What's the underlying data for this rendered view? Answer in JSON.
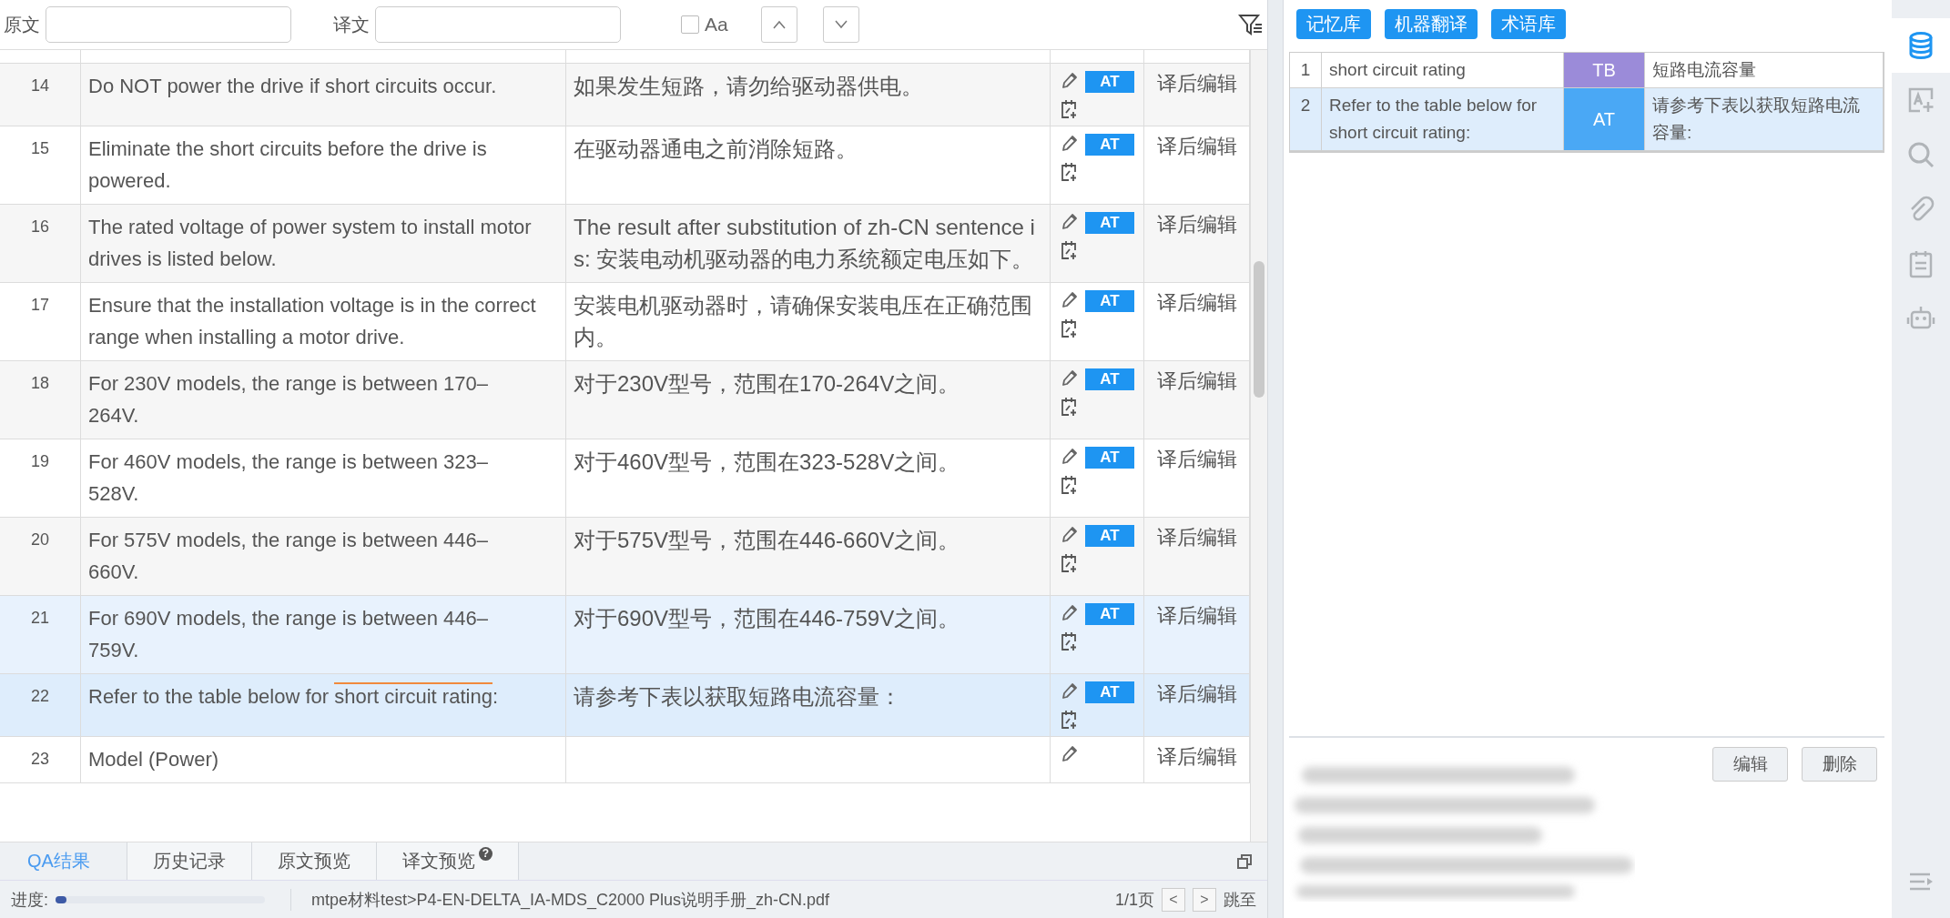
{
  "toolbar": {
    "source_label": "原文",
    "target_label": "译文",
    "case_label": "Aa",
    "case_checked": false
  },
  "segments": [
    {
      "number": "14",
      "source": "Do NOT power the drive if short circuits occur.",
      "target": "如果发生短路，请勿给驱动器供电。",
      "badge": "AT",
      "status": "译后编辑",
      "selected": false,
      "hovered": false
    },
    {
      "number": "15",
      "source": "Eliminate the short circuits before the drive is powered.",
      "target": "在驱动器通电之前消除短路。",
      "badge": "AT",
      "status": "译后编辑",
      "selected": false,
      "hovered": false
    },
    {
      "number": "16",
      "source": "The rated voltage of power system to install motor drives is listed below.",
      "target": "The result after substitution of zh-CN sentence is: 安装电动机驱动器的电力系统额定电压如下。",
      "badge": "AT",
      "status": "译后编辑",
      "selected": false,
      "hovered": false
    },
    {
      "number": "17",
      "source": "Ensure that the installation voltage is in the correct range when installing a motor drive.",
      "target": "安装电机驱动器时，请确保安装电压在正确范围内。",
      "badge": "AT",
      "status": "译后编辑",
      "selected": false,
      "hovered": false
    },
    {
      "number": "18",
      "source": "For 230V models, the range is between 170–264V.",
      "target": "对于230V型号，范围在170-264V之间。",
      "badge": "AT",
      "status": "译后编辑",
      "selected": false,
      "hovered": false
    },
    {
      "number": "19",
      "source": "For 460V models, the range is between 323–528V.",
      "target": "对于460V型号，范围在323-528V之间。",
      "badge": "AT",
      "status": "译后编辑",
      "selected": false,
      "hovered": false
    },
    {
      "number": "20",
      "source": "For 575V models, the range is between 446–660V.",
      "target": "对于575V型号，范围在446-660V之间。",
      "badge": "AT",
      "status": "译后编辑",
      "selected": false,
      "hovered": false
    },
    {
      "number": "21",
      "source": "For 690V models, the range is between 446–759V.",
      "target": "对于690V型号，范围在446-759V之间。",
      "badge": "AT",
      "status": "译后编辑",
      "selected": false,
      "hovered": true
    },
    {
      "number": "22",
      "source_parts": [
        {
          "text": "Refer to the table below for ",
          "term": false
        },
        {
          "text": "short circuit rating",
          "term": true
        },
        {
          "text": ":",
          "term": false
        }
      ],
      "target": "请参考下表以获取短路电流容量：",
      "badge": "AT",
      "status": "译后编辑",
      "selected": true,
      "hovered": false
    },
    {
      "number": "23",
      "source": "Model (Power)",
      "status": "译后编辑",
      "selected": false,
      "hovered": false
    }
  ],
  "bottom_tabs": [
    {
      "label": "QA结果",
      "selected": true
    },
    {
      "label": "历史记录",
      "selected": false
    },
    {
      "label": "原文预览",
      "selected": false
    },
    {
      "label": "译文预览",
      "selected": false,
      "help": "?"
    }
  ],
  "status_bar": {
    "progress_label": "进度:",
    "progress": {
      "level": 0.05
    },
    "path": "mtpe材料test>P4-EN-DELTA_IA-MDS_C2000 Plus说明手册_zh-CN.pdf",
    "page": "1/1页",
    "prev": "<",
    "next": ">",
    "jump": "跳至"
  },
  "side_panel": {
    "buttons": [
      "记忆库",
      "机器翻译",
      "术语库"
    ],
    "matches": [
      {
        "index": "1",
        "source": "short circuit rating",
        "badge": "TB",
        "color": "#9b8bd9",
        "target": "短路电流容量",
        "selected": false
      },
      {
        "index": "2",
        "source": "Refer to the table below for short circuit rating:",
        "badge": "AT",
        "color": "#4aa8f5",
        "target": "请参考下表以获取短路电流容量:",
        "selected": true
      }
    ],
    "actions": [
      "编辑",
      "删除"
    ]
  },
  "rail": [
    {
      "kind": "database",
      "selected": true
    },
    {
      "kind": "image-text",
      "selected": false
    },
    {
      "kind": "search",
      "selected": false
    },
    {
      "kind": "clip",
      "selected": false
    },
    {
      "kind": "checklist",
      "selected": false
    },
    {
      "kind": "robot",
      "selected": false
    },
    {
      "kind": "menu",
      "selected": false
    }
  ]
}
